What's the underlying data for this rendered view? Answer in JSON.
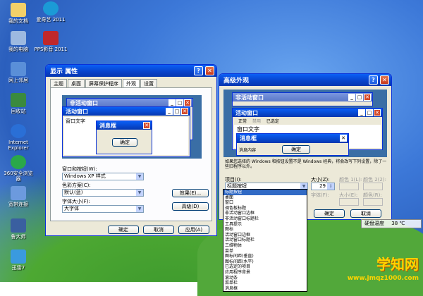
{
  "desktop_icons": [
    {
      "label": "我的文档",
      "icon": "folder-docs-icon"
    },
    {
      "label": "爱奇艺 2011",
      "icon": "video-app-icon"
    },
    {
      "label": "我的电脑",
      "icon": "computer-icon"
    },
    {
      "label": "PPS影音 2011",
      "icon": "media-app-icon"
    },
    {
      "label": "网上邻居",
      "icon": "network-icon"
    },
    {
      "label": "回收站",
      "icon": "recycle-bin-icon"
    },
    {
      "label": "Internet Explorer",
      "icon": "ie-icon"
    },
    {
      "label": "360安全浏览器",
      "icon": "browser-icon"
    },
    {
      "label": "宽带连接",
      "icon": "broadband-icon"
    },
    {
      "label": "鲁大师",
      "icon": "tool-icon"
    },
    {
      "label": "迅雷7",
      "icon": "download-icon"
    }
  ],
  "display_props": {
    "title": "显示 属性",
    "tabs": [
      "主题",
      "桌面",
      "屏幕保护程序",
      "外观",
      "设置"
    ],
    "preview": {
      "inactive_title": "非活动窗口",
      "active_title": "活动窗口",
      "window_text": "窗口文字",
      "msgbox_title": "消息框",
      "ok": "确定"
    },
    "style_label": "窗口和按钮(W):",
    "style_value": "Windows XP 样式",
    "scheme_label": "色彩方案(C):",
    "scheme_value": "默认(蓝)",
    "font_label": "字体大小(F):",
    "font_value": "大字体",
    "effects_btn": "效果(E)...",
    "advanced_btn": "高级(D)",
    "ok": "确定",
    "cancel": "取消",
    "apply": "应用(A)"
  },
  "advanced": {
    "title": "高级外观",
    "preview": {
      "inactive_title": "非活动窗口",
      "active_title": "活动窗口",
      "menu_normal": "正常",
      "menu_disabled": "禁用",
      "menu_selected": "已选定",
      "window_text": "窗口文字",
      "msgbox_title": "消息框",
      "msg_content": "消息内容",
      "ok": "确定"
    },
    "note": "如果您选择的 Windows 和按钮设置不是 Windows 经典，将会改写下列设置，除了一些旧程序以外。",
    "item_label": "项目(I):",
    "item_value": "标题按钮",
    "size_label": "大小(Z):",
    "size_value": "29",
    "color1_label": "颜色 1(L):",
    "color2_label": "颜色 2(2):",
    "font_label": "字体(F):",
    "font_size_label": "大小(E):",
    "font_color_label": "颜色(R):",
    "ok": "确定",
    "cancel": "取消",
    "dropdown_items": [
      "标题按钮",
      "桌面",
      "窗口",
      "调色板标题",
      "非活动窗口边框",
      "非活动窗口标题栏",
      "工具提示",
      "图标",
      "活动窗口边框",
      "活动窗口标题栏",
      "三维物体",
      "菜单",
      "图标间距(垂直)",
      "图标间距(水平)",
      "已选定的项目",
      "应用程序背景",
      "滚动条",
      "菜单栏",
      "消息框"
    ]
  },
  "temp_widget": {
    "label": "硬盘温度",
    "value": "38 ℃"
  },
  "watermark": {
    "title": "学知网",
    "url": "www.jmqz1000.com"
  }
}
